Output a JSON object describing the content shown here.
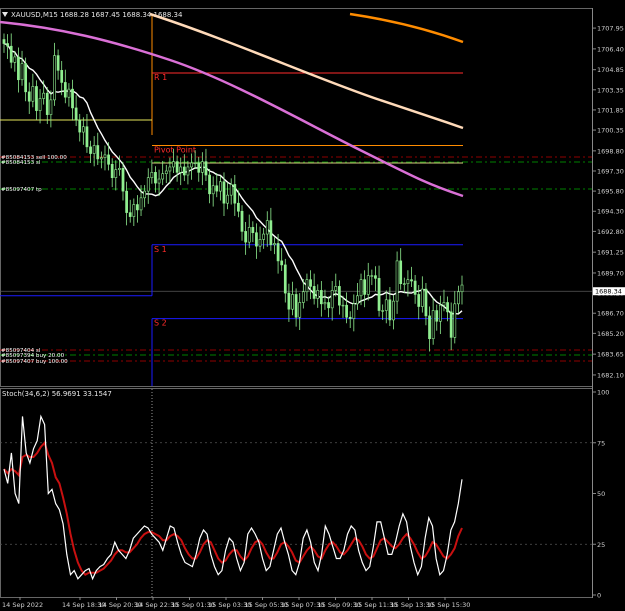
{
  "header": {
    "title": "XAUUSD,M15",
    "ohlc": "1688.28 1687.45 1688.34 1688.34"
  },
  "stoch_label": "Stoch(34,6,2) 56.9691 33.1547",
  "colors": {
    "bg": "#000000",
    "bull": "#90ee90",
    "bear": "#90ee90",
    "ma_fast": "#ffffff",
    "ma_mid": "#da70d6",
    "ma_slow": "#ffdab9",
    "ma_orange": "#ff8c00",
    "stoch_main": "#ffffff",
    "stoch_signal": "#c81010",
    "pivot": "#ff8c00",
    "r_line": "#ff2b2b",
    "s_line": "#1a1aff"
  },
  "chart_data": [
    {
      "type": "candlestick",
      "title": "XAUUSD,M15",
      "ylim": [
        1681.5,
        1709.0
      ],
      "price_ticks": [
        "1707.95",
        "1706.40",
        "1704.85",
        "1703.35",
        "1701.85",
        "1700.35",
        "1698.80",
        "1697.30",
        "1695.80",
        "1694.30",
        "1692.80",
        "1691.25",
        "1689.70",
        "1688.20",
        "1686.70",
        "1685.20",
        "1683.65",
        "1682.10"
      ],
      "current_price": "1688.34",
      "x_labels": [
        "14 Sep 2022",
        "14 Sep 18:30",
        "14 Sep 20:30",
        "14 Sep 22:30",
        "15 Sep 01:30",
        "15 Sep 03:30",
        "15 Sep 05:30",
        "15 Sep 07:30",
        "15 Sep 09:30",
        "15 Sep 11:30",
        "15 Sep 13:30",
        "15 Sep 15:30"
      ],
      "pivot_levels": [
        {
          "label": "R 1",
          "value": 1704.6
        },
        {
          "label": "Pivot Point",
          "value": 1699.2
        },
        {
          "label": "S 1",
          "value": 1691.8
        },
        {
          "label": "S 2",
          "value": 1686.3
        }
      ],
      "order_lines": [
        {
          "label": "#85084153 sell 100.00",
          "value": 1697.7
        },
        {
          "label": "#85084153 sl",
          "value": 1697.2
        },
        {
          "label": "#85097407 tp",
          "value": 1695.7
        },
        {
          "label": "#85097404 sl",
          "value": 1684.6
        },
        {
          "label": "#85097394 buy 20.00",
          "value": 1684.2
        },
        {
          "label": "#85097407 buy 100.00",
          "value": 1683.6
        }
      ],
      "closes": [
        1706.8,
        1706.6,
        1705.4,
        1705.8,
        1704.1,
        1705.3,
        1703.2,
        1702.5,
        1703.6,
        1701.8,
        1702.7,
        1703.1,
        1701.5,
        1702.6,
        1705.9,
        1704.8,
        1703.9,
        1702.8,
        1703.4,
        1702.0,
        1701.1,
        1700.2,
        1700.6,
        1699.1,
        1698.6,
        1699.2,
        1698.2,
        1698.3,
        1698.5,
        1697.8,
        1696.8,
        1697.4,
        1697.5,
        1695.8,
        1694.2,
        1693.9,
        1694.8,
        1694.4,
        1695.3,
        1695.8,
        1696.8,
        1697.2,
        1696.4,
        1696.7,
        1697.1,
        1697.3,
        1697.6,
        1698.0,
        1697.2,
        1697.6,
        1697.0,
        1697.6,
        1697.9,
        1697.9,
        1697.2,
        1698.0,
        1697.0,
        1695.6,
        1696.2,
        1695.8,
        1696.5,
        1694.9,
        1695.5,
        1696.3,
        1694.9,
        1694.3,
        1692.8,
        1692.0,
        1693.1,
        1692.7,
        1691.7,
        1692.2,
        1692.6,
        1693.6,
        1691.8,
        1691.9,
        1690.6,
        1690.3,
        1688.2,
        1687.0,
        1688.1,
        1686.4,
        1687.5,
        1688.3,
        1689.2,
        1688.7,
        1687.8,
        1688.4,
        1687.4,
        1687.5,
        1687.1,
        1688.4,
        1688.7,
        1687.3,
        1687.3,
        1686.4,
        1686.3,
        1687.4,
        1688.0,
        1689.2,
        1688.1,
        1689.5,
        1689.5,
        1689.3,
        1686.9,
        1686.9,
        1687.7,
        1686.2,
        1687.6,
        1690.6,
        1688.9,
        1688.9,
        1689.2,
        1689.1,
        1688.1,
        1687.2,
        1688.5,
        1686.5,
        1684.8,
        1686.9,
        1686.1,
        1687.3,
        1687.5,
        1686.8,
        1684.9,
        1687.4,
        1688.3,
        1688.8
      ],
      "stoch_main": [
        62,
        55,
        70,
        50,
        45,
        88,
        70,
        65,
        72,
        76,
        88,
        84,
        50,
        52,
        45,
        42,
        35,
        20,
        10,
        12,
        8,
        10,
        12,
        13,
        8,
        12,
        14,
        15,
        18,
        20,
        26,
        22,
        20,
        18,
        22,
        28,
        30,
        32,
        34,
        33,
        30,
        28,
        26,
        22,
        28,
        34,
        33,
        26,
        20,
        16,
        15,
        14,
        20,
        28,
        32,
        30,
        20,
        14,
        10,
        12,
        22,
        28,
        26,
        18,
        12,
        16,
        30,
        33,
        30,
        26,
        18,
        12,
        14,
        22,
        30,
        33,
        26,
        20,
        12,
        10,
        16,
        28,
        32,
        26,
        16,
        12,
        20,
        34,
        30,
        24,
        18,
        18,
        22,
        30,
        34,
        32,
        22,
        16,
        12,
        14,
        24,
        36,
        36,
        28,
        20,
        20,
        26,
        34,
        40,
        36,
        24,
        16,
        10,
        14,
        28,
        38,
        34,
        18,
        10,
        12,
        20,
        32,
        36,
        45,
        57
      ],
      "stoch_signal": [
        62,
        60,
        62,
        61,
        59,
        68,
        69,
        68,
        68,
        70,
        73,
        75,
        69,
        65,
        58,
        55,
        48,
        40,
        30,
        22,
        16,
        12,
        10,
        11,
        11,
        11,
        12,
        13,
        15,
        17,
        20,
        22,
        22,
        21,
        21,
        23,
        25,
        28,
        30,
        31,
        31,
        30,
        29,
        27,
        27,
        29,
        30,
        29,
        27,
        23,
        20,
        18,
        18,
        21,
        25,
        27,
        26,
        22,
        18,
        16,
        17,
        20,
        22,
        22,
        19,
        17,
        19,
        23,
        26,
        27,
        25,
        21,
        18,
        18,
        21,
        25,
        26,
        24,
        21,
        17,
        16,
        19,
        22,
        24,
        22,
        19,
        18,
        22,
        25,
        26,
        24,
        21,
        20,
        22,
        25,
        28,
        27,
        24,
        20,
        18,
        19,
        23,
        27,
        28,
        26,
        24,
        23,
        25,
        28,
        30,
        28,
        25,
        21,
        18,
        19,
        22,
        26,
        25,
        22,
        19,
        18,
        20,
        23,
        29,
        33
      ]
    }
  ]
}
